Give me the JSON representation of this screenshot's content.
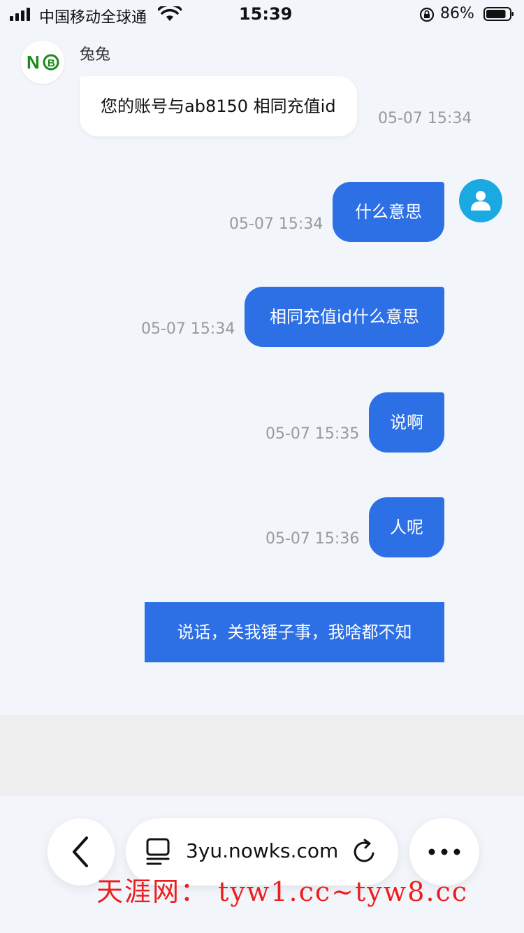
{
  "status_bar": {
    "carrier": "中国移动全球通",
    "time": "15:39",
    "battery_percent": "86%",
    "battery_level": 0.86
  },
  "chat": {
    "incoming": {
      "sender_name": "兔兔",
      "avatar_text": "NⒷ",
      "text": "您的账号与ab8150 相同充值id",
      "time": "05-07 15:34"
    },
    "outgoing": [
      {
        "text": "什么意思",
        "time": "05-07 15:34"
      },
      {
        "text": "相同充值id什么意思",
        "time": "05-07 15:34"
      },
      {
        "text": "说啊",
        "time": "05-07 15:35"
      },
      {
        "text": "人呢",
        "time": "05-07 15:36"
      },
      {
        "text": "说话，关我锤子事，我啥都不知",
        "time": ""
      }
    ]
  },
  "browser_toolbar": {
    "url": "3yu.nowks.com"
  },
  "watermark": "天涯网：  tyw1.cc~tyw8.cc",
  "colors": {
    "outgoing_bubble": "#2d6fe4",
    "avatar_right": "#1ba9e1",
    "watermark": "#ee1d1d"
  }
}
